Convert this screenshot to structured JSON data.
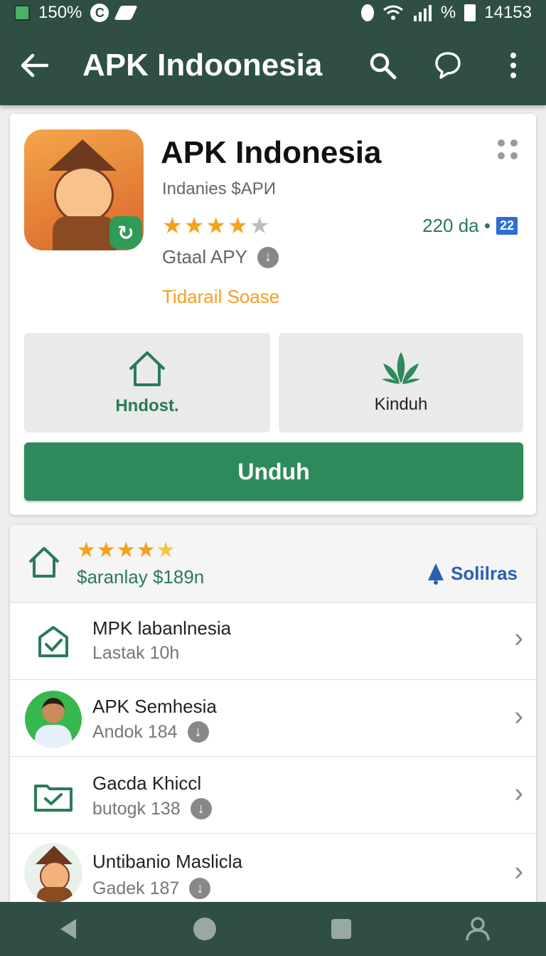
{
  "status_bar": {
    "left_text": "150%",
    "right_percent": "%",
    "time": "14153"
  },
  "app_bar": {
    "title": "APK Indoonesia"
  },
  "app": {
    "name": "APK Indonesia",
    "subtitle": "Indanies $APИ",
    "rating_stars": 4,
    "size_label": "Gtaal APY",
    "orange_text": "Tidarail Soase",
    "downloads": "220 da •",
    "badge_number": "22"
  },
  "actions": {
    "left_label": "Hndost.",
    "right_label": "Kinduh",
    "primary_label": "Unduh"
  },
  "list": {
    "header": {
      "price": "$aranlay $189n",
      "link": "Solilras"
    },
    "items": [
      {
        "title": "MPK labanlnesia",
        "sub": "Lastak 10h"
      },
      {
        "title": "APK Semhesia",
        "sub": "Andok 184"
      },
      {
        "title": "Gacda Khiccl",
        "sub": "butogk 138"
      },
      {
        "title": "Untibanio Maslicla",
        "sub": "Gadek 187"
      }
    ]
  },
  "colors": {
    "bar": "#2f4f45",
    "primary_green": "#2e8a5b",
    "star": "#f2a21c",
    "link_blue": "#2b5fb3"
  }
}
